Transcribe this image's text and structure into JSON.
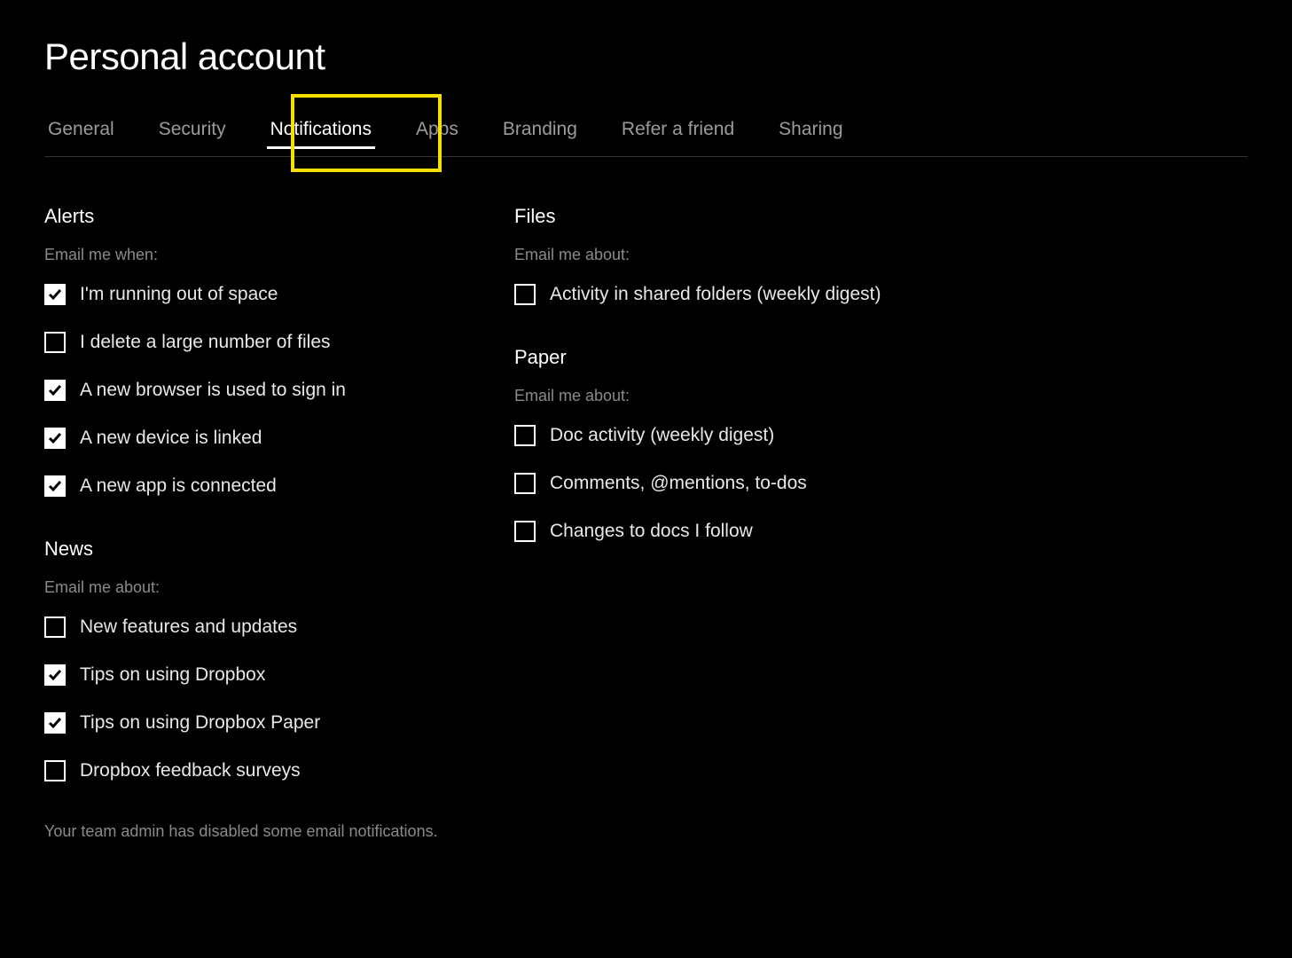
{
  "pageTitle": "Personal account",
  "tabs": [
    {
      "label": "General",
      "active": false
    },
    {
      "label": "Security",
      "active": false
    },
    {
      "label": "Notifications",
      "active": true
    },
    {
      "label": "Apps",
      "active": false
    },
    {
      "label": "Branding",
      "active": false
    },
    {
      "label": "Refer a friend",
      "active": false
    },
    {
      "label": "Sharing",
      "active": false
    }
  ],
  "sections": {
    "alerts": {
      "title": "Alerts",
      "sub": "Email me when:",
      "items": [
        {
          "label": "I'm running out of space",
          "checked": true
        },
        {
          "label": "I delete a large number of files",
          "checked": false
        },
        {
          "label": "A new browser is used to sign in",
          "checked": true
        },
        {
          "label": "A new device is linked",
          "checked": true
        },
        {
          "label": "A new app is connected",
          "checked": true
        }
      ]
    },
    "news": {
      "title": "News",
      "sub": "Email me about:",
      "items": [
        {
          "label": "New features and updates",
          "checked": false
        },
        {
          "label": "Tips on using Dropbox",
          "checked": true
        },
        {
          "label": "Tips on using Dropbox Paper",
          "checked": true
        },
        {
          "label": "Dropbox feedback surveys",
          "checked": false
        }
      ]
    },
    "files": {
      "title": "Files",
      "sub": "Email me about:",
      "items": [
        {
          "label": "Activity in shared folders (weekly digest)",
          "checked": false
        }
      ]
    },
    "paper": {
      "title": "Paper",
      "sub": "Email me about:",
      "items": [
        {
          "label": "Doc activity (weekly digest)",
          "checked": false
        },
        {
          "label": "Comments, @mentions, to-dos",
          "checked": false
        },
        {
          "label": "Changes to docs I follow",
          "checked": false
        }
      ]
    }
  },
  "footerNote": "Your team admin has disabled some email notifications."
}
